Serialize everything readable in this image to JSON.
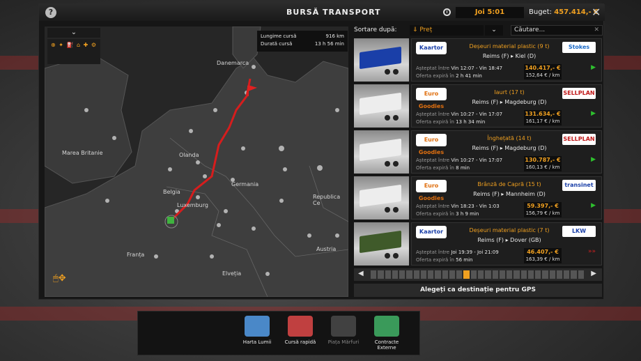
{
  "window": {
    "title": "BURSĂ TRANSPORT",
    "time": "Joi 5:01",
    "budget_label": "Buget:",
    "budget_value": "457.414,- €",
    "close_icon": "close-icon",
    "help_icon": "help-icon"
  },
  "map": {
    "collapse_glyph": "⌄",
    "filter_glyphs": "⊕ ✦ ⛽ ⌂ ✚ ⚙",
    "route_info": {
      "length_label": "Lungime cursă",
      "length_value": "916 km",
      "duration_label": "Durată cursă",
      "duration_value": "13 h 56 min"
    },
    "labels": {
      "danemarca": "Danemarca",
      "marea_britanie": "Marea Britanie",
      "olanda": "Olanda",
      "germania": "Germania",
      "belgia": "Belgia",
      "luxemburg": "Luxemburg",
      "republica_ce": "Republica Ce",
      "franta": "Franța",
      "austria": "Austria",
      "elvetia": "Elveția"
    }
  },
  "sort": {
    "label": "Sortare după:",
    "selected": "Preț",
    "search_placeholder": "Căutare..."
  },
  "jobs": [
    {
      "company": "Kaartor",
      "cargo": "Deșeuri material plastic (9 t)",
      "origin": "Reims (F)",
      "destination": "Kiel (D)",
      "dest_company": "Stokes",
      "waiting_label": "Așteptat între",
      "window": "Vin 12:07 - Vin 18:47",
      "expires_label": "Oferta expiră în",
      "expires": "2 h 41 min",
      "price": "140.417,- €",
      "per_km": "152,64 € / km",
      "status": "green",
      "color": "#1a3fa8"
    },
    {
      "company": "Euro Goodies",
      "cargo": "Iaurt (17 t)",
      "origin": "Reims (F)",
      "destination": "Magdeburg (D)",
      "dest_company": "SELLPLAN",
      "waiting_label": "Așteptat între",
      "window": "Vin 10:27 - Vin 17:07",
      "expires_label": "Oferta expiră în",
      "expires": "13 h 34 min",
      "price": "131.634,- €",
      "per_km": "161,17 € / km",
      "status": "green",
      "color": "#ededed"
    },
    {
      "company": "Euro Goodies",
      "cargo": "Înghețată (14 t)",
      "origin": "Reims (F)",
      "destination": "Magdeburg (D)",
      "dest_company": "SELLPLAN",
      "waiting_label": "Așteptat între",
      "window": "Vin 10:27 - Vin 17:07",
      "expires_label": "Oferta expiră în",
      "expires": "8 min",
      "price": "130.787,- €",
      "per_km": "160,13 € / km",
      "status": "green",
      "color": "#ededed"
    },
    {
      "company": "Euro Goodies",
      "cargo": "Brânză de Capră (15 t)",
      "origin": "Reims (F)",
      "destination": "Mannheim (D)",
      "dest_company": "transinet",
      "waiting_label": "Așteptat între",
      "window": "Vin 18:23 - Vin 1:03",
      "expires_label": "Oferta expiră în",
      "expires": "3 h 9 min",
      "price": "59.397,- €",
      "per_km": "156,79 € / km",
      "status": "green",
      "color": "#ededed"
    },
    {
      "company": "Kaartor",
      "cargo": "Deșeuri material plastic (7 t)",
      "origin": "Reims (F)",
      "destination": "Dover (GB)",
      "dest_company": "LKW",
      "waiting_label": "Așteptat între",
      "window": "Joi 19:39 - Joi 21:09",
      "expires_label": "Oferta expiră în",
      "expires": "56 min",
      "price": "46.407,- €",
      "per_km": "163,39 € / km",
      "status": "red",
      "color": "#3f5a2a"
    }
  ],
  "pager": {
    "prev": "◀",
    "next": "▶"
  },
  "gps_button": "Alegeți ca destinație pentru GPS",
  "dock": [
    {
      "label": "Harta Lumii",
      "icon": "world-map-icon",
      "dim": false
    },
    {
      "label": "Cursă rapidă",
      "icon": "quick-job-icon",
      "dim": false
    },
    {
      "label": "Piața Mărfuri",
      "icon": "freight-market-icon",
      "dim": true
    },
    {
      "label": "Contracte Externe",
      "icon": "external-contracts-icon",
      "dim": false
    }
  ]
}
